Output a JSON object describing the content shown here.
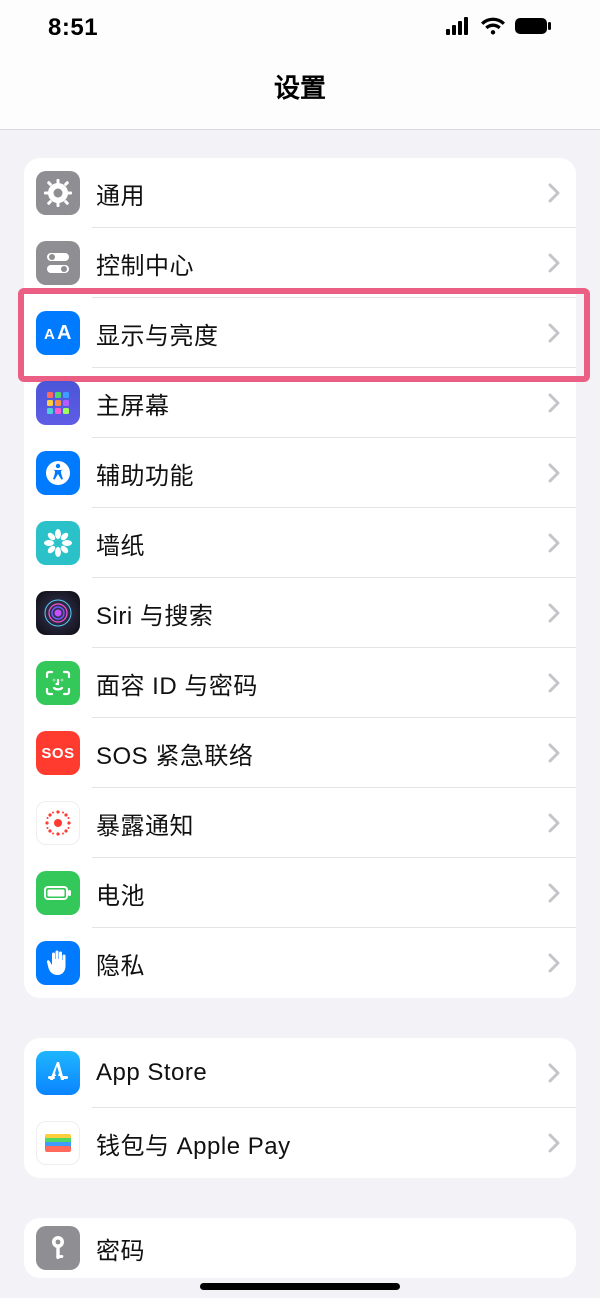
{
  "status": {
    "time": "8:51"
  },
  "header": {
    "title": "设置"
  },
  "groups": [
    {
      "rows": [
        {
          "id": "general",
          "icon": "gear",
          "label": "通用"
        },
        {
          "id": "control-center",
          "icon": "switches",
          "label": "控制中心"
        },
        {
          "id": "display",
          "icon": "aa",
          "label": "显示与亮度",
          "highlighted": true
        },
        {
          "id": "home-screen",
          "icon": "apps-grid",
          "label": "主屏幕"
        },
        {
          "id": "accessibility",
          "icon": "accessibility",
          "label": "辅助功能"
        },
        {
          "id": "wallpaper",
          "icon": "flower",
          "label": "墙纸"
        },
        {
          "id": "siri",
          "icon": "siri",
          "label": "Siri 与搜索"
        },
        {
          "id": "faceid",
          "icon": "faceid",
          "label": "面容 ID 与密码"
        },
        {
          "id": "sos",
          "icon": "sos",
          "label": "SOS 紧急联络"
        },
        {
          "id": "exposure",
          "icon": "exposure",
          "label": "暴露通知"
        },
        {
          "id": "battery",
          "icon": "battery",
          "label": "电池"
        },
        {
          "id": "privacy",
          "icon": "hand",
          "label": "隐私"
        }
      ]
    },
    {
      "rows": [
        {
          "id": "appstore",
          "icon": "appstore",
          "label": "App Store"
        },
        {
          "id": "wallet",
          "icon": "wallet",
          "label": "钱包与 Apple Pay"
        }
      ]
    },
    {
      "rows": [
        {
          "id": "passwords",
          "icon": "key",
          "label": "密码"
        }
      ]
    }
  ]
}
